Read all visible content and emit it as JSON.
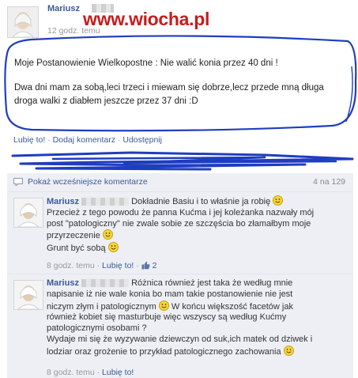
{
  "watermark": "www.wiocha.pl",
  "post": {
    "author": "Mariusz",
    "time": "12 godz. temu",
    "paragraphs": [
      "Moje Postanowienie Wielkopostne : Nie walić konia przez 40 dni !",
      "Dwa dni mam za sobą,leci trzeci i miewam się dobrze,lecz przede mną długa droga walki z diabłem jeszcze przez 37 dni :D"
    ],
    "actions": {
      "like": "Lubię to!",
      "comment": "Dodaj komentarz",
      "share": "Udostępnij",
      "sep": "·"
    }
  },
  "comments_header": {
    "label": "Pokaż wcześniejsze komentarze",
    "count": "4 na 129"
  },
  "comments": [
    {
      "author": "Mariusz",
      "lines": [
        "Dokładnie Basiu i to właśnie ja robię",
        "Przecież z tego powodu że panna Kućma i jej koleżanka nazwały mój",
        "post \"patologiczny\" nie zwale sobie ze szczęścia bo złamałbym moje",
        "przyrzeczenie",
        "Grunt być sobą"
      ],
      "time": "8 godz. temu",
      "like": "Lubię to!",
      "likes_count": "2"
    },
    {
      "author": "Mariusz",
      "lines": [
        "Różnica również jest taka że według mnie",
        "napisanie iż nie wale konia bo mam takie postanowienie nie jest",
        "niczym złym i patologicznym",
        "W końcu większość facetów jak",
        "również kobiet się masturbuje więc wszyscy są według Kućmy",
        "patologicznymi osobami ?",
        "Wydaje mi się że wyzywanie dziewczyn od suk,ich matek od dziwek i",
        "lodziar oraz grożenie to przykład patologicznego zachowania"
      ],
      "time": "8 godz. temu",
      "like": "Lubię to!"
    }
  ],
  "colors": {
    "link": "#3b5998",
    "watermark": "#c71c1c",
    "marker": "#1f3dbf",
    "comment_bg": "#edeff4"
  },
  "icons": {
    "smiley": "smiley-icon",
    "thumb": "thumbs-up-icon",
    "comments": "comment-bubble-icon"
  }
}
